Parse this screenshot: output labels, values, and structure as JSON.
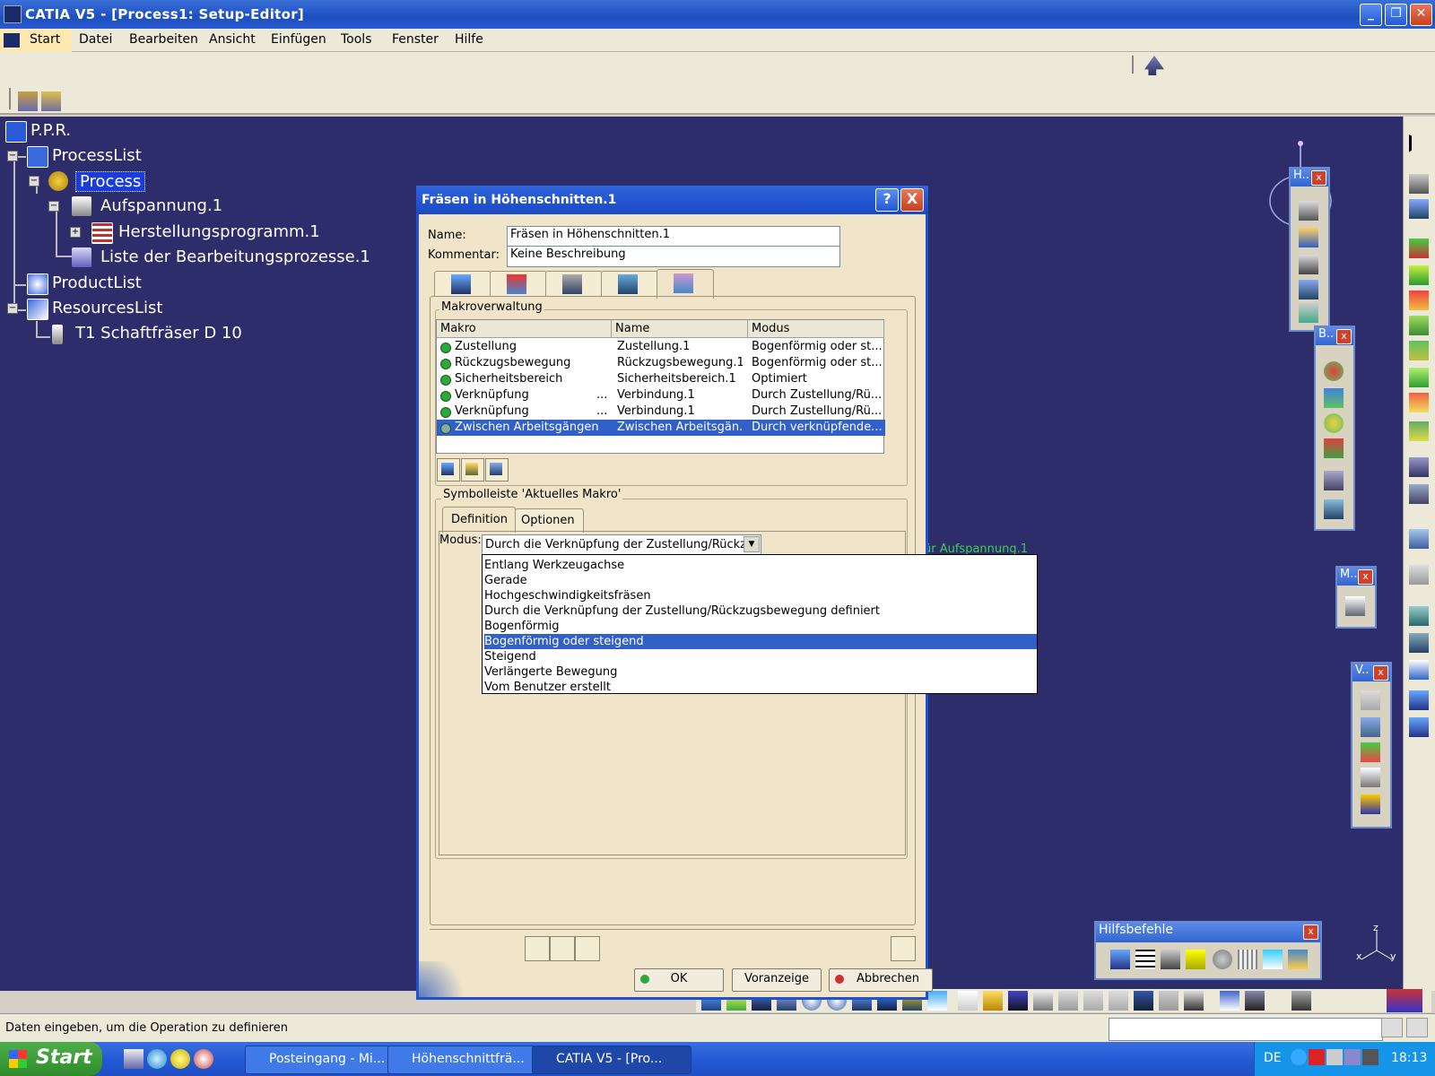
{
  "window": {
    "title": "CATIA V5 - [Process1: Setup-Editor]"
  },
  "menubar": {
    "items": [
      "Start",
      "Datei",
      "Bearbeiten",
      "Ansicht",
      "Einfügen",
      "Tools",
      "Fenster",
      "Hilfe"
    ]
  },
  "tree": {
    "root": "P.P.R.",
    "process_list": "ProcessList",
    "process": "Process",
    "setup": "Aufspannung.1",
    "program": "Herstellungsprogramm.1",
    "machining_list": "Liste der Bearbeitungsprozesse.1",
    "product_list": "ProductList",
    "resources_list": "ResourcesList",
    "tool": "T1 Schaftfräser D 10"
  },
  "dialog": {
    "title": "Fräsen in Höhenschnitten.1",
    "help_label": "?",
    "close_label": "X",
    "name_label": "Name:",
    "name_value": "Fräsen in Höhenschnitten.1",
    "comment_label": "Kommentar:",
    "comment_value": "Keine Beschreibung",
    "macro_group": "Makroverwaltung",
    "columns": [
      "Makro",
      "Name",
      "Modus"
    ],
    "rows": [
      {
        "makro": "Zustellung",
        "ell": "",
        "name": "Zustellung.1",
        "modus": "Bogenförmig oder st..."
      },
      {
        "makro": "Rückzugsbewegung",
        "ell": "",
        "name": "Rückzugsbewegung.1",
        "modus": "Bogenförmig oder st..."
      },
      {
        "makro": "Sicherheitsbereich",
        "ell": "",
        "name": "Sicherheitsbereich.1",
        "modus": "Optimiert"
      },
      {
        "makro": "Verknüpfung",
        "ell": "...",
        "name": "Verbindung.1",
        "modus": "Durch Zustellung/Rü..."
      },
      {
        "makro": "Verknüpfung",
        "ell": "...",
        "name": "Verbindung.1",
        "modus": "Durch Zustellung/Rü..."
      },
      {
        "makro": "Zwischen Arbeitsgängen",
        "ell": "",
        "name": "Zwischen Arbeitsgän...",
        "modus": "Durch verknüpfende..."
      }
    ],
    "current_macro_group": "Symbolleiste 'Aktuelles Makro'",
    "subtabs": [
      "Definition",
      "Optionen"
    ],
    "mode_label": "Modus:",
    "mode_value": "Durch die Verknüpfung der Zustellung/Rückzu",
    "mode_options": [
      "Entlang Werkzeugachse",
      "Gerade",
      "Hochgeschwindigkeitsfräsen",
      "Durch die Verknüpfung der Zustellung/Rückzugsbewegung definiert",
      "Bogenförmig",
      "Bogenförmig oder steigend",
      "Steigend",
      "Verlängerte Bewegung",
      "Vom Benutzer erstellt"
    ],
    "highlighted_option": "Bogenförmig oder steigend",
    "ok_label": "OK",
    "preview_label": "Voranzeige",
    "cancel_label": "Abbrechen"
  },
  "background_label": "ür Aufspannung.1",
  "floating_toolbars": {
    "h": "H..",
    "b": "B..",
    "m": "M..",
    "v": "V..",
    "hilfsbefehle": "Hilfsbefehle",
    "close": "x"
  },
  "axis": {
    "z": "z",
    "x": "x",
    "y": "y"
  },
  "statusbar": {
    "text": "Daten eingeben, um die Operation zu definieren"
  },
  "taskbar": {
    "start": "Start",
    "tasks": [
      "Posteingang - Mi...",
      "Höhenschnittfrä...",
      "CATIA V5 - [Pro..."
    ],
    "lang": "DE",
    "time": "18:13"
  },
  "colors": {
    "workspace": "#2d2d6b",
    "accent": "#2150d0",
    "dialog_bg": "#f0e5c8",
    "selection": "#3161c8"
  }
}
